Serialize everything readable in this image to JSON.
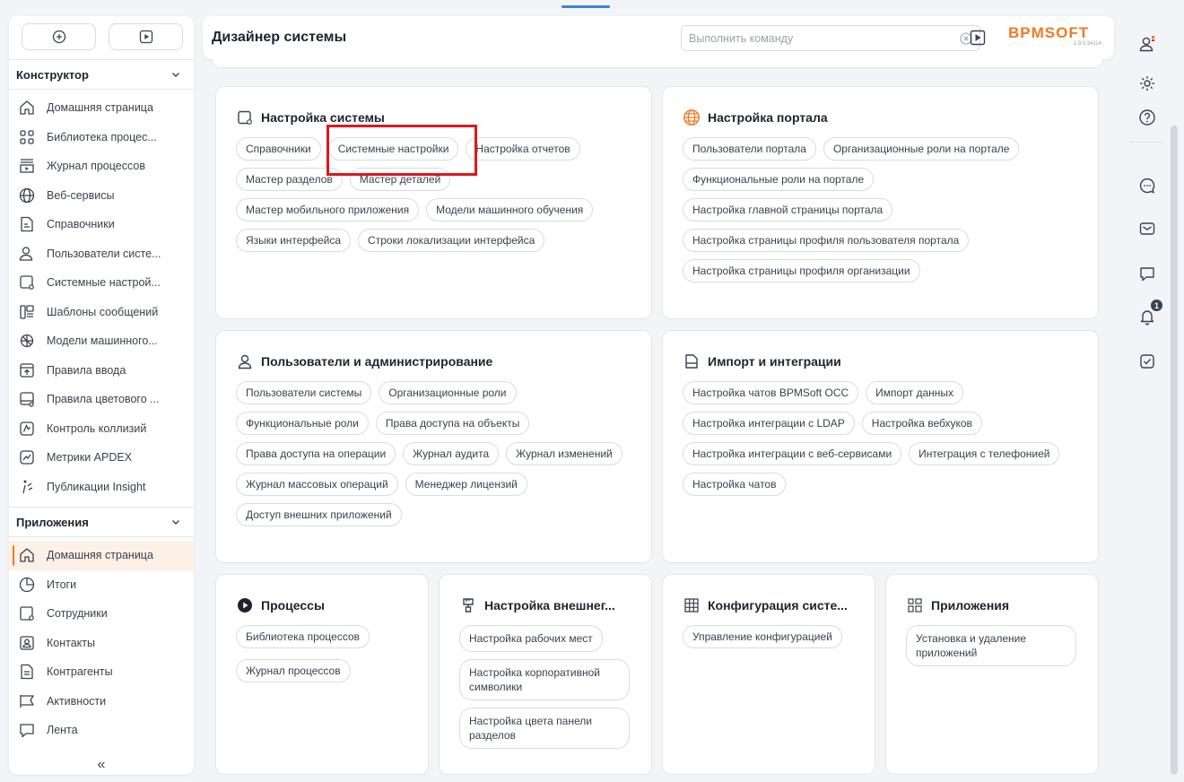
{
  "header": {
    "title": "Дизайнер системы",
    "command_placeholder": "Выполнить команду",
    "logo": "BPMSOFT",
    "version": "1.9.0.34114"
  },
  "sidebar": {
    "section1": "Конструктор",
    "items1": [
      {
        "label": "Домашняя страница",
        "icon": "home-icon"
      },
      {
        "label": "Библиотека процес...",
        "icon": "process-library-icon"
      },
      {
        "label": "Журнал процессов",
        "icon": "process-log-icon"
      },
      {
        "label": "Веб-сервисы",
        "icon": "globe-icon"
      },
      {
        "label": "Справочники",
        "icon": "lookup-icon"
      },
      {
        "label": "Пользователи систе...",
        "icon": "user-icon"
      },
      {
        "label": "Системные настрой...",
        "icon": "system-settings-icon"
      },
      {
        "label": "Шаблоны сообщений",
        "icon": "message-template-icon"
      },
      {
        "label": "Модели машинного...",
        "icon": "ml-model-icon"
      },
      {
        "label": "Правила ввода",
        "icon": "input-rules-icon"
      },
      {
        "label": "Правила цветового ...",
        "icon": "color-rules-icon"
      },
      {
        "label": "Контроль коллизий",
        "icon": "collision-icon"
      },
      {
        "label": "Метрики APDEX",
        "icon": "metrics-icon"
      },
      {
        "label": "Публикации Insight",
        "icon": "insight-icon"
      }
    ],
    "section2": "Приложения",
    "items2": [
      {
        "label": "Домашняя страница",
        "icon": "home-icon"
      },
      {
        "label": "Итоги",
        "icon": "chart-icon"
      },
      {
        "label": "Сотрудники",
        "icon": "employees-icon"
      },
      {
        "label": "Контакты",
        "icon": "contacts-icon"
      },
      {
        "label": "Контрагенты",
        "icon": "accounts-icon"
      },
      {
        "label": "Активности",
        "icon": "flag-icon"
      },
      {
        "label": "Лента",
        "icon": "feed-icon"
      }
    ],
    "collapse": "«"
  },
  "cards": {
    "system": {
      "title": "Настройка системы",
      "chips": [
        "Справочники",
        "Системные настройки",
        "Настройка отчетов",
        "Мастер разделов",
        "Мастер деталей",
        "Мастер мобильного приложения",
        "Модели машинного обучения",
        "Языки интерфейса",
        "Строки локализации интерфейса"
      ]
    },
    "portal": {
      "title": "Настройка портала",
      "chips": [
        "Пользователи портала",
        "Организационные роли на портале",
        "Функциональные роли на портале",
        "Настройка главной страницы портала",
        "Настройка страницы профиля пользователя портала",
        "Настройка страницы профиля организации"
      ]
    },
    "users": {
      "title": "Пользователи и администрирование",
      "chips": [
        "Пользователи системы",
        "Организационные роли",
        "Функциональные роли",
        "Права доступа на объекты",
        "Права доступа на операции",
        "Журнал аудита",
        "Журнал изменений",
        "Журнал массовых операций",
        "Менеджер лицензий",
        "Доступ внешних приложений"
      ]
    },
    "import": {
      "title": "Импорт и интеграции",
      "chips": [
        "Настройка чатов BPMSoft OCC",
        "Импорт данных",
        "Настройка интеграции с LDAP",
        "Настройка вебхуков",
        "Настройка интеграции с веб-сервисами",
        "Интеграция с телефонией",
        "Настройка чатов"
      ]
    },
    "processes": {
      "title": "Процессы",
      "chips": [
        "Библиотека процессов",
        "Журнал процессов"
      ]
    },
    "external": {
      "title": "Настройка внешнег...",
      "chips": [
        "Настройка рабочих мест",
        "Настройка корпоративной символики",
        "Настройка цвета панели разделов"
      ]
    },
    "config": {
      "title": "Конфигурация систе...",
      "chips": [
        "Управление конфигурацией"
      ]
    },
    "apps": {
      "title": "Приложения",
      "chips": [
        "Установка и удаление приложений"
      ]
    }
  },
  "rail": {
    "notifications_count": "1"
  },
  "colors": {
    "accent": "#f07a26",
    "highlight": "#e0161b",
    "text": "#1f2330"
  }
}
